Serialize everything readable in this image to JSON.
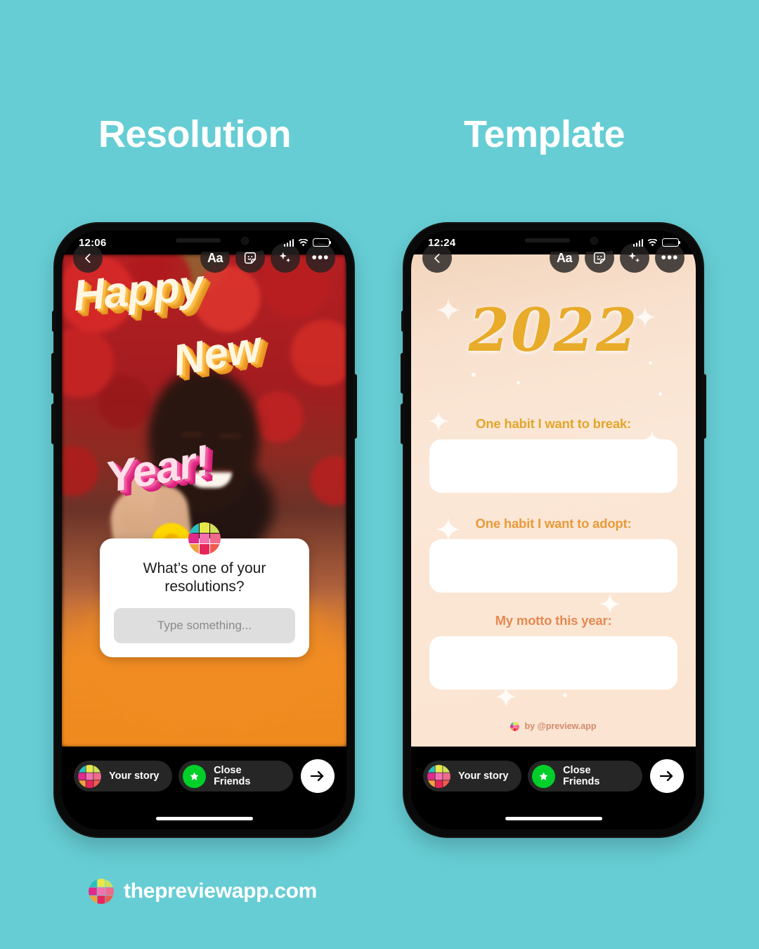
{
  "page": {
    "background_color": "#66cdd4",
    "headings": {
      "left": "Resolution",
      "right": "Template"
    },
    "footer": {
      "brand": "thepreviewapp.com",
      "logo_icon": "preview-grid-logo-icon"
    }
  },
  "phone_resolution": {
    "status": {
      "time": "12:06",
      "signal_icon": "cellular-signal-icon",
      "wifi_icon": "wifi-icon",
      "battery_icon": "battery-icon"
    },
    "tools": {
      "back_icon": "chevron-left-icon",
      "text_label": "Aa",
      "sticker_icon": "sticker-smiley-icon",
      "sparkle_icon": "sparkles-icon",
      "more_icon": "more-dots-icon"
    },
    "story_text": {
      "line1": "Happy",
      "line2": "New",
      "line3": "Year!",
      "line1_color": "#fff6e2",
      "line1_shadow": "#f0a830",
      "line3_color": "#ffdfe8",
      "line3_shadow": "#de2780"
    },
    "question_sticker": {
      "logo_icon": "preview-grid-logo-icon",
      "question": "What’s one of your resolutions?",
      "input_placeholder": "Type something..."
    },
    "share_bar": {
      "your_story": "Your story",
      "close_friends": "Close Friends",
      "close_friends_icon": "green-star-icon",
      "your_story_icon": "preview-grid-logo-icon",
      "send_icon": "arrow-right-icon"
    }
  },
  "phone_template": {
    "status": {
      "time": "12:24",
      "signal_icon": "cellular-signal-icon",
      "wifi_icon": "wifi-icon",
      "battery_icon": "battery-icon"
    },
    "tools": {
      "back_icon": "chevron-left-icon",
      "text_label": "Aa",
      "sticker_icon": "sticker-smiley-icon",
      "sparkle_icon": "sparkles-icon",
      "more_icon": "more-dots-icon"
    },
    "content": {
      "year": "2022",
      "year_color": "#e8ab2a",
      "background_gradient": [
        "#f2d5bc",
        "#fbe6d4"
      ],
      "fields": [
        {
          "label": "One habit I want to break:",
          "value": "",
          "accent": "#eeb23b"
        },
        {
          "label": "One habit I want to adopt:",
          "value": "",
          "accent": "#f0a43a"
        },
        {
          "label": "My motto this year:",
          "value": "",
          "accent": "#ea8f58"
        }
      ],
      "credit": "by @preview.app",
      "credit_icon": "preview-grid-logo-icon"
    },
    "share_bar": {
      "your_story": "Your story",
      "close_friends": "Close Friends",
      "close_friends_icon": "green-star-icon",
      "your_story_icon": "preview-grid-logo-icon",
      "send_icon": "arrow-right-icon"
    }
  }
}
